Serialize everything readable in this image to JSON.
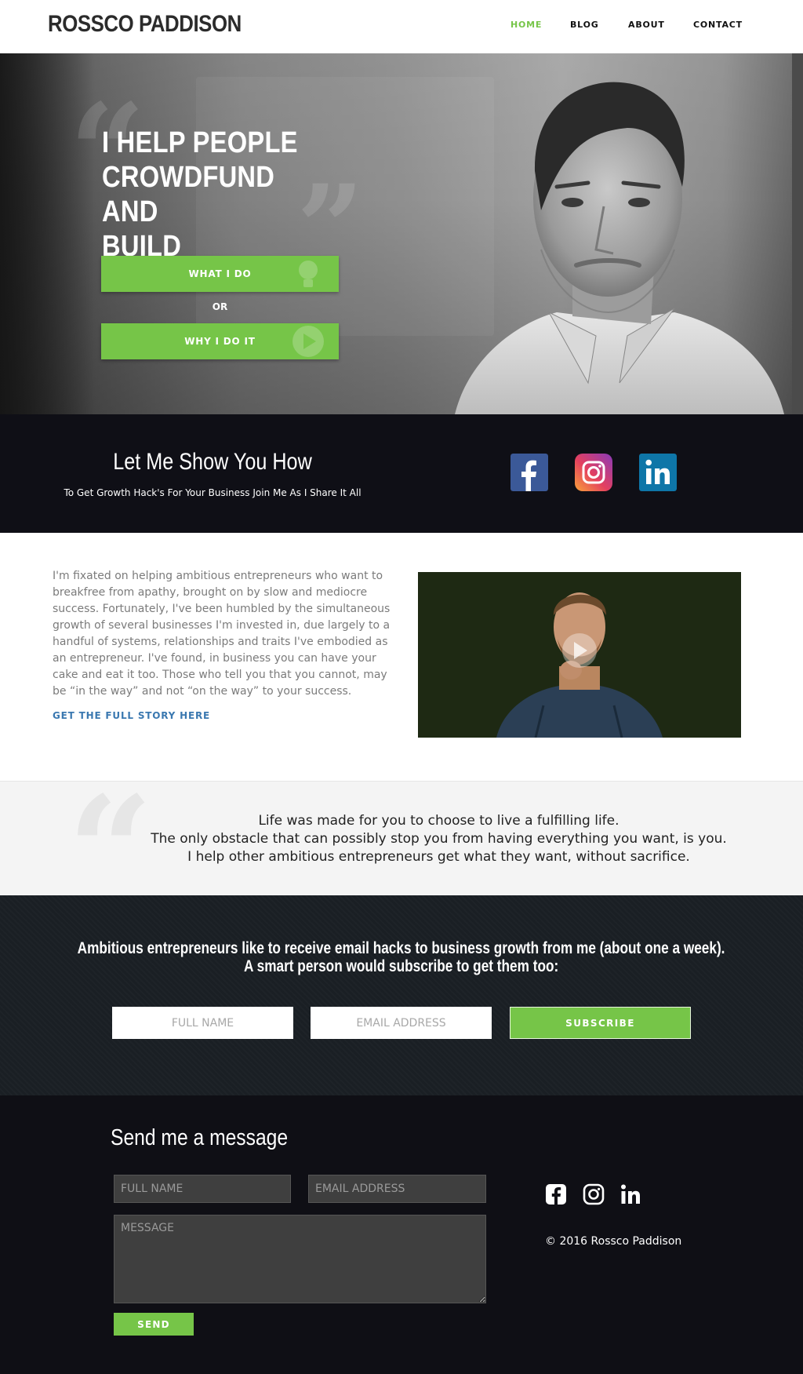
{
  "header": {
    "logo": "ROSSCO PADDISON",
    "nav": [
      "HOME",
      "BLOG",
      "ABOUT",
      "CONTACT"
    ]
  },
  "hero": {
    "title": "I HELP PEOPLE\nCROWDFUND AND\nBUILD BUSINESSES.",
    "btn_what": "WHAT I DO",
    "or": "OR",
    "btn_why": "WHY I DO IT"
  },
  "showhow": {
    "title": "Let Me Show You How",
    "subtitle": "To Get Growth Hack's For Your Business Join Me As I Share It All",
    "socials": [
      "facebook-icon",
      "instagram-icon",
      "linkedin-icon"
    ]
  },
  "story": {
    "text": "I'm fixated on helping ambitious entrepreneurs who want to breakfree from apathy, brought on by slow and mediocre success. Fortunately, I've been humbled by the simultaneous growth of several businesses I'm invested in, due largely to a handful of systems, relationships and traits I've embodied as an entrepreneur. I've found, in business you can have your cake and eat it too. Those who tell you that you cannot, may be “in the way” and not “on the way” to your success.",
    "link": "GET THE FULL STORY HERE"
  },
  "quote": {
    "lines": [
      "Life was made for you to choose to live a fulfilling life.",
      "The only obstacle that can possibly stop you from having everything you want, is you.",
      "I help other ambitious entrepreneurs get what they want, without sacrifice."
    ]
  },
  "subscribe": {
    "line1": "Ambitious entrepreneurs like to receive email hacks to business growth from me (about one a week).",
    "line2": "A smart person would subscribe to get them too:",
    "name_placeholder": "FULL NAME",
    "email_placeholder": "EMAIL ADDRESS",
    "button": "SUBSCRIBE"
  },
  "footer": {
    "title": "Send me a message",
    "name_placeholder": "FULL NAME",
    "email_placeholder": "EMAIL ADDRESS",
    "message_placeholder": "MESSAGE",
    "send": "SEND",
    "copyright": "© 2016 Rossco Paddison"
  },
  "colors": {
    "accent": "#76c548",
    "dark": "#0f0f16",
    "link": "#3a78b0"
  }
}
